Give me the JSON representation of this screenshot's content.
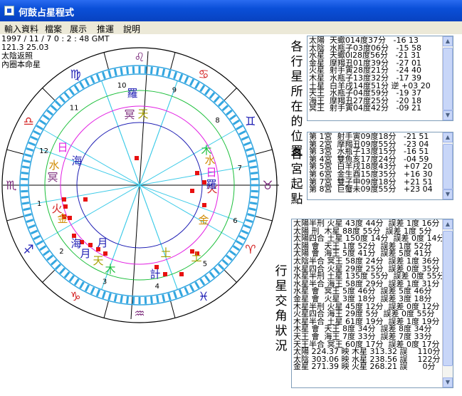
{
  "window": {
    "title": "何鼓占星程式"
  },
  "menu": [
    "輸入資料",
    "檔案",
    "展示",
    "推運",
    "說明"
  ],
  "info": {
    "datetime": "1997 / 11 / 7    0 : 2 : 48 GMT",
    "coords": "121.3   25.03",
    "line3": "太陰返照",
    "line4": "內圈本命星"
  },
  "zodiac": [
    "♈",
    "♉",
    "♊",
    "♋",
    "♌",
    "♍",
    "♎",
    "♏",
    "♐",
    "♑",
    "♒",
    "♓"
  ],
  "houses": [
    "1",
    "2",
    "3",
    "4",
    "5",
    "6",
    "7",
    "8",
    "9",
    "10",
    "11",
    "12"
  ],
  "chart_planets": {
    "saturn_o": "土",
    "saturn_i": "土",
    "jupiter_o": "木",
    "jupiter_i": "木",
    "mars_o": "火",
    "mars_i": "火",
    "sun_o": "日",
    "sun_i": "日",
    "mercury_o": "水",
    "mercury_i": "水",
    "venus_o": "金",
    "venus_i": "金",
    "moon_o": "月",
    "moon_i": "月",
    "neptune_o": "海",
    "neptune_i": "海",
    "uranus_o": "天",
    "uranus_i": "天",
    "pluto_o": "冥",
    "pluto_i": "冥",
    "rahu_o": "羅",
    "rahu_i": "羅",
    "ketu": "計"
  },
  "labels": {
    "planet_pos": "各行星所在的位置",
    "house_cusps": "各宮起點",
    "aspects": "行星交角狀況"
  },
  "planet_positions": [
    "太陽  天蠍014度37分   -16 13",
    "太陰  水瓶子03度06分   -15 58",
    "水星  天蠍0l28度56分   -21 31",
    "金星  摩羯丑01度39分   -27 01",
    "火星  射手寅28度21分   -24 40",
    "木星  水瓶子13度32分   -17 39",
    "土星  白羊戌14度51分 逆 +03 20",
    "天王  水瓶子04度59分   -19 37",
    "海王  摩羯丑27度25分   -20 18",
    "冥王  射手寅04度42分   -09 21"
  ],
  "house_list": [
    "第 1宮  射手寅09度18分   -21 51",
    "第 2宮  摩羯丑09度55分   -23 04",
    "第 3宮  水瓶子13度15分   -16 51",
    "第 4宮  雙魚亥17度24分   -04 59",
    "第 5宮  白羊戌18度43分   +07 20",
    "第 6宮  金生酉15度35分   +16 30",
    "第 7宮  雙子申09度18分   +21 51",
    "第 8宮  巨蟹未09度55分   +23 04"
  ],
  "aspects": [
    "太陽半刑 火星 43度 44分  誤差 1度 16分",
    "太陽 刑  木星 88度 55分  誤差 1度 5分",
    "太陽四合 土星 150度 14分  誤差 0度 14分",
    "太陽 會  天王 1度 52分  誤差 1度 52分",
    "太陽 會  海王 5度 41分  誤差 5度 41分",
    "太陰半合 冥王 58度 24分  誤差 1度 36分",
    "水星四合 火星 29度 25分  誤差 0度 35分",
    "水星半刑 土星 135度 55分  誤差 0度 55分",
    "水星半合 海王 58度 29分  誤差 1度 31分",
    "水星 會  冥王 5度 46分  誤差 5度 46分",
    "金星 會  火星 3度 18分  誤差 3度 18分",
    "木星半刑 火星 45度 12分  誤差 0度 12分",
    "火星四合 海王 29度 5分  誤差 0度 55分",
    "木星半合 土星 61度 19分  誤差 1度 19分",
    "木星 會  天王 8度 34分  誤差 8度 34分",
    "天王 會  海王 7度 33分  誤差 7度 33分",
    "天王半合 冥王 60度 17分  誤差 0度 17分",
    "太陽 224.37 映 木星 313.32 誤    110分",
    "太陰 303.06 映 水星 238.56 誤    122分",
    "金星 271.39 映 火星 268.21 誤      0分"
  ]
}
